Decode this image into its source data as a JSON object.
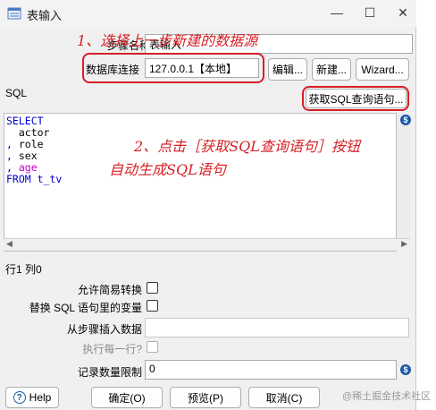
{
  "window": {
    "title": "表输入",
    "controls": {
      "minimize": "—",
      "maximize": "☐",
      "close": "✕"
    }
  },
  "step_name": {
    "label": "步骤名称",
    "value": "表输入"
  },
  "connection": {
    "label": "数据库连接",
    "value": "127.0.0.1【本地】",
    "edit_button": "编辑...",
    "new_button": "新建...",
    "wizard_button": "Wizard..."
  },
  "sql": {
    "label": "SQL",
    "get_sql_button": "获取SQL查询语句...",
    "lines": [
      {
        "prefix": "",
        "text": "SELECT",
        "style": "kw"
      },
      {
        "prefix": "  ",
        "text": "actor",
        "style": "id"
      },
      {
        "prefix": ", ",
        "text": "role",
        "style": "id"
      },
      {
        "prefix": ", ",
        "text": "sex",
        "style": "id"
      },
      {
        "prefix": ", ",
        "text": "age",
        "style": "hl"
      },
      {
        "prefix": "",
        "text": "FROM t_tv",
        "style": "kw"
      }
    ]
  },
  "cursor_position": "行1 列0",
  "options": {
    "lazy_conversion": {
      "label": "允许简易转换",
      "checked": false
    },
    "replace_vars": {
      "label": "替换 SQL 语句里的变量",
      "checked": false
    },
    "insert_from_step": {
      "label": "从步骤插入数据",
      "value": ""
    },
    "execute_each_row": {
      "label": "执行每一行?",
      "checked": false,
      "disabled": true
    },
    "limit_size": {
      "label": "记录数量限制",
      "value": "0"
    }
  },
  "footer": {
    "help_button": "Help",
    "ok_button": "确定(O)",
    "preview_button": "预览(P)",
    "cancel_button": "取消(C)"
  },
  "annotations": {
    "step1": "1、选择上一步新建的数据源",
    "step2_line1": "2、点击［获取SQL查询语句］按钮",
    "step2_line2": "自动生成SQL语句"
  },
  "watermark": "@稀土掘金技术社区",
  "colors": {
    "annotation": "#d61f26",
    "sql_keyword": "#0000c8",
    "sql_highlight": "#c000c0"
  }
}
